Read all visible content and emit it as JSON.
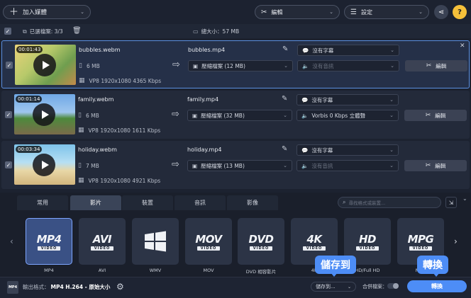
{
  "toolbar": {
    "add_media": "加入媒體",
    "edit": "編輯",
    "settings": "設定"
  },
  "summary": {
    "selected": "已選檔案: 3/3",
    "total_size": "總大小：57 MB"
  },
  "files": [
    {
      "duration": "00:01:43",
      "source_name": "bubbles.webm",
      "size": "6 MB",
      "codec": "VP8 1920x1080 4365 Kbps",
      "output_name": "bubbles.mp4",
      "output_size": "壓縮檔案 (12 MB)",
      "subtitle": "沒有字幕",
      "audio": "沒有音訊",
      "audio_active": false,
      "edit_label": "編輯"
    },
    {
      "duration": "00:01:14",
      "source_name": "family.webm",
      "size": "6 MB",
      "codec": "VP8 1920x1080 1611 Kbps",
      "output_name": "family.mp4",
      "output_size": "壓縮檔案 (32 MB)",
      "subtitle": "沒有字幕",
      "audio": "Vorbis 0 Kbps 立體聲",
      "audio_active": true,
      "edit_label": "編輯"
    },
    {
      "duration": "00:03:34",
      "source_name": "holiday.webm",
      "size": "7 MB",
      "codec": "VP8 1920x1080 4921 Kbps",
      "output_name": "holiday.mp4",
      "output_size": "壓縮檔案 (13 MB)",
      "subtitle": "沒有字幕",
      "audio": "沒有音訊",
      "audio_active": false,
      "edit_label": "編輯"
    }
  ],
  "tabs": [
    "常用",
    "影片",
    "裝置",
    "音訊",
    "影像"
  ],
  "active_tab": 1,
  "format_search_placeholder": "尋找格式或裝置...",
  "formats": [
    {
      "big": "MP4",
      "sub": "VIDEO",
      "label": "MP4",
      "active": true
    },
    {
      "big": "AVI",
      "sub": "VIDEO",
      "label": "AVI",
      "active": false
    },
    {
      "big": "",
      "sub": "",
      "label": "WMV",
      "active": false,
      "icon": "windows-logo-icon"
    },
    {
      "big": "MOV",
      "sub": "VIDEO",
      "label": "MOV",
      "active": false
    },
    {
      "big": "DVD",
      "sub": "VIDEO",
      "label": "DVD 相容影片",
      "active": false
    },
    {
      "big": "4K",
      "sub": "VIDEO",
      "label": "4K",
      "active": false
    },
    {
      "big": "HD",
      "sub": "VIDEO",
      "label": "HD/Full HD",
      "active": false
    },
    {
      "big": "MPG",
      "sub": "VIDEO",
      "label": "MPG",
      "active": false
    }
  ],
  "bottom": {
    "output_format_label": "輸出格式：",
    "output_format_value": "MP4 H.264 - 原始大小",
    "save_to": "儲存到...",
    "merge": "合併檔案：",
    "convert": "轉換"
  },
  "callouts": {
    "save_to": "儲存到",
    "convert": "轉換"
  },
  "colors": {
    "accent": "#4d8df6",
    "background": "#1c2230"
  }
}
